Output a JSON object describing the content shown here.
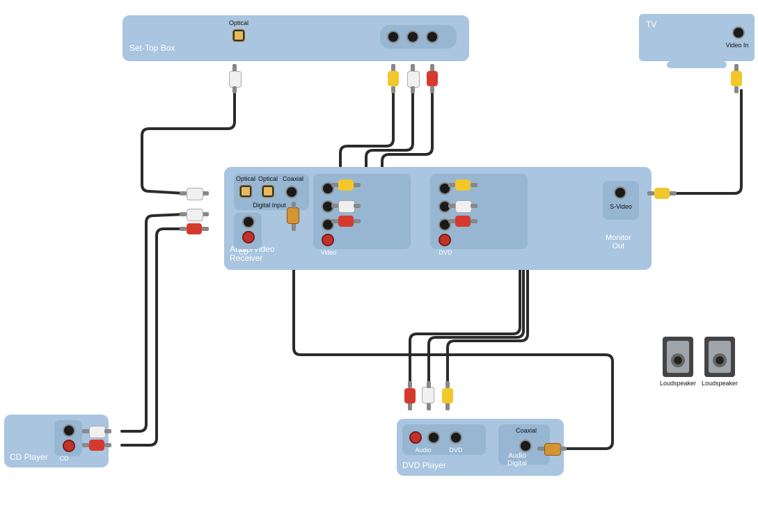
{
  "devices": {
    "settop": {
      "label": "Set-Top Box",
      "optical_label": "Optical"
    },
    "tv": {
      "label": "TV",
      "video_in_label": "Video In"
    },
    "receiver": {
      "label": "Audio/Video\nReceiver",
      "digital_input_label": "Digital Input",
      "optical1_label": "Optical",
      "optical2_label": "Optical",
      "coaxial_label": "Coaxial",
      "cd_label": "CD",
      "video_label": "Video",
      "dvd_label": "DVD",
      "monitor_out_label": "Monitor\nOut",
      "svideo_label": "S-Video"
    },
    "cdplayer": {
      "label": "CD Player",
      "cd_label": "CD"
    },
    "dvdplayer": {
      "label": "DVD Player",
      "audio_label": "Audio",
      "dvd_label": "DVD",
      "audio_digital_label": "Audio\nDigital",
      "coaxial_label": "Coaxial"
    },
    "loudspeaker_label": "Loudspeaker"
  },
  "colors": {
    "panel": "#a9c5df",
    "cable": "#2b2b2b",
    "red": "#d63a2e",
    "white": "#f0f0f0",
    "yellow": "#f2c72b"
  },
  "connections": [
    {
      "from": "Set-Top Box Optical",
      "to": "Receiver Digital Input Optical",
      "type": "optical"
    },
    {
      "from": "Set-Top Box A/V out (Y/W/R)",
      "to": "Receiver Video in (Y/W/R)",
      "type": "composite+stereo"
    },
    {
      "from": "CD Player L/R out",
      "to": "Receiver CD L/R in",
      "type": "stereo-rca"
    },
    {
      "from": "DVD Player Audio L/R",
      "to": "Receiver DVD Audio L/R",
      "type": "stereo-rca"
    },
    {
      "from": "DVD Player Composite video",
      "to": "Receiver DVD Video",
      "type": "composite"
    },
    {
      "from": "DVD Player Coaxial digital",
      "to": "Receiver Digital Input Coaxial",
      "type": "coaxial"
    },
    {
      "from": "Receiver Monitor Out (S-Video/Composite)",
      "to": "TV Video In",
      "type": "composite"
    },
    {
      "from": "Receiver",
      "to": "Loudspeakers (L/R)",
      "type": "speaker (implied)"
    }
  ]
}
